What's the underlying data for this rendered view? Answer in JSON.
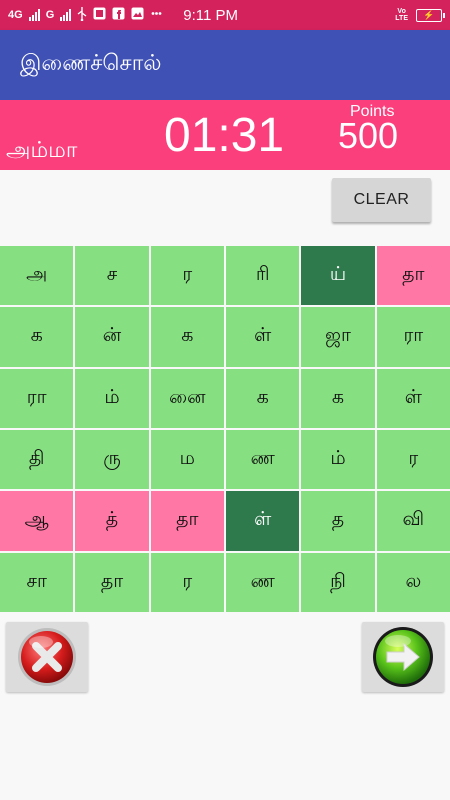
{
  "status_bar": {
    "network_left": "4G",
    "network_right": "G",
    "time": "9:11 PM",
    "lte_top": "Vo",
    "lte_bottom": "LTE",
    "battery_symbol": "⚡"
  },
  "app": {
    "title": "இணைச்சொல்"
  },
  "game": {
    "current_word": "அம்மா",
    "timer": "01:31",
    "points_label": "Points",
    "points_value": "500",
    "clear_label": "CLEAR"
  },
  "grid": {
    "rows": [
      [
        "அ",
        "ச",
        "ர",
        "ரி",
        "ய்",
        "தா"
      ],
      [
        "க",
        "ன்",
        "க",
        "ள்",
        "ஜா",
        "ரா"
      ],
      [
        "ரா",
        "ம்",
        "னை",
        "க",
        "க",
        "ள்"
      ],
      [
        "தி",
        "ரு",
        "ம",
        "ண",
        "ம்",
        "ர"
      ],
      [
        "ஆ",
        "த்",
        "தா",
        "ள்",
        "த",
        "வி"
      ],
      [
        "சா",
        "தா",
        "ர",
        "ண",
        "நி",
        "ல"
      ]
    ],
    "highlight_states": [
      [
        "normal",
        "normal",
        "normal",
        "normal",
        "selected",
        "matched"
      ],
      [
        "normal",
        "normal",
        "normal",
        "normal",
        "normal",
        "normal"
      ],
      [
        "normal",
        "normal",
        "normal",
        "normal",
        "normal",
        "normal"
      ],
      [
        "normal",
        "normal",
        "normal",
        "normal",
        "normal",
        "normal"
      ],
      [
        "matched",
        "matched",
        "matched",
        "selected",
        "normal",
        "normal"
      ],
      [
        "normal",
        "normal",
        "normal",
        "normal",
        "normal",
        "normal"
      ]
    ]
  },
  "colors": {
    "status_bar": "#d3225c",
    "app_bar": "#3f51b5",
    "score_bar": "#fb3f7d",
    "cell_normal": "#86df80",
    "cell_selected": "#2f7a4d",
    "cell_matched": "#fe77a5"
  },
  "icons": {
    "cancel": "red-x-icon",
    "next": "green-arrow-icon"
  }
}
